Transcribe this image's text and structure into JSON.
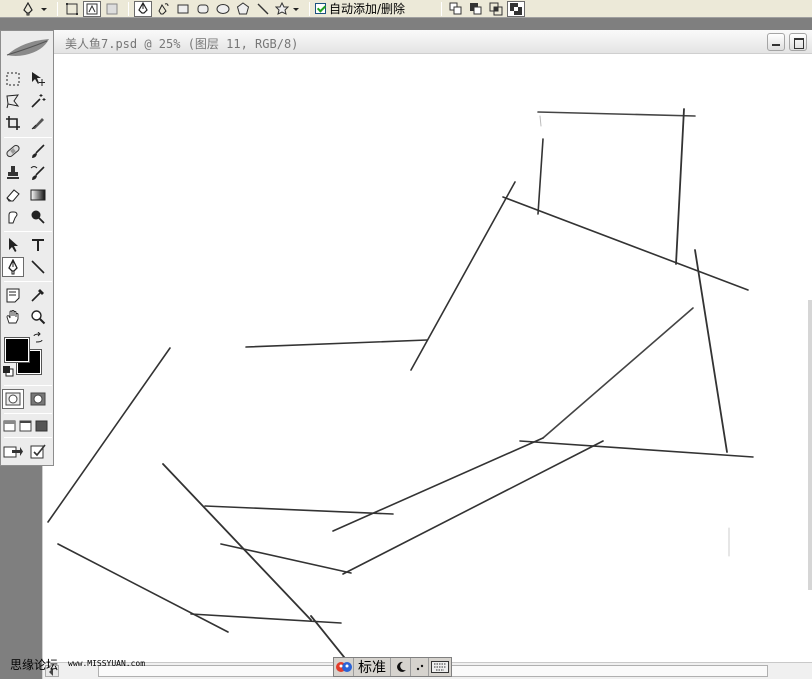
{
  "options_bar": {
    "auto_add_delete_label": "自动添加/删除",
    "auto_add_delete_checked": true
  },
  "document": {
    "title": "美人鱼7.psd @ 25% (图层 11, RGB/8)"
  },
  "watermark": {
    "site_name": "思缘论坛",
    "site_url": "www.MISSYUAN.com"
  },
  "ime_bar": {
    "mode_label": "标准"
  },
  "colors": {
    "foreground": "#000000",
    "background": "#000000",
    "workspace": "#7f7f7f"
  }
}
